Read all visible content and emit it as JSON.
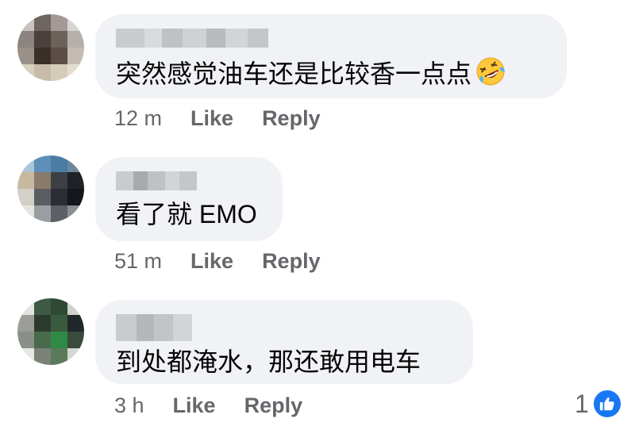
{
  "comments": [
    {
      "text": "突然感觉油车还是比较香一点点",
      "emoji": "rolling-on-floor-laughing-emoji",
      "time": "12 m",
      "like_label": "Like",
      "reply_label": "Reply"
    },
    {
      "text": "看了就 EMO",
      "time": "51 m",
      "like_label": "Like",
      "reply_label": "Reply"
    },
    {
      "text": "到处都淹水，那还敢用电车",
      "time": "3 h",
      "like_label": "Like",
      "reply_label": "Reply",
      "reaction_count": "1",
      "reaction_icon": "thumbs-up-icon"
    }
  ],
  "colors": {
    "bubble_bg": "#f0f2f5",
    "meta_text": "#65676b",
    "like_blue": "#1877f2"
  }
}
